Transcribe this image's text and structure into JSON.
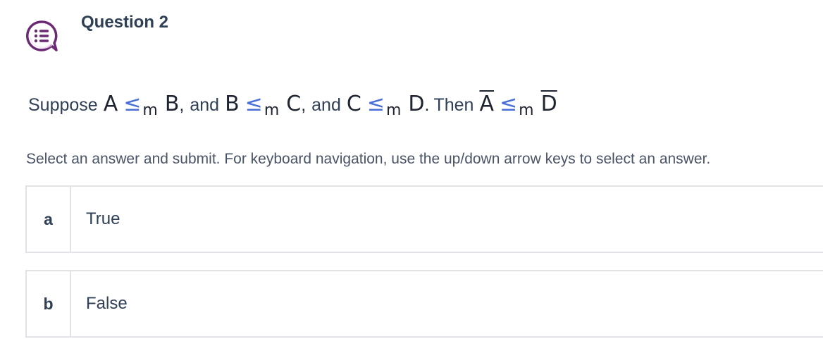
{
  "question": {
    "title": "Question 2",
    "icon": "quiz-list-icon",
    "prompt": {
      "suppose": "Suppose",
      "and": "and",
      "then": "Then",
      "rel": "≤",
      "sub": "m",
      "a": "A",
      "b": "B",
      "c": "C",
      "d": "D",
      "comma": ",",
      "period": "."
    }
  },
  "instructions": "Select an answer and submit. For keyboard navigation, use the up/down arrow keys to select an answer.",
  "options": [
    {
      "letter": "a",
      "text": "True"
    },
    {
      "letter": "b",
      "text": "False"
    }
  ],
  "colors": {
    "icon_purple": "#6b2a73",
    "relation_blue": "#4a6fd8",
    "text_dark": "#2f3f55",
    "border": "#e2e3e8"
  }
}
